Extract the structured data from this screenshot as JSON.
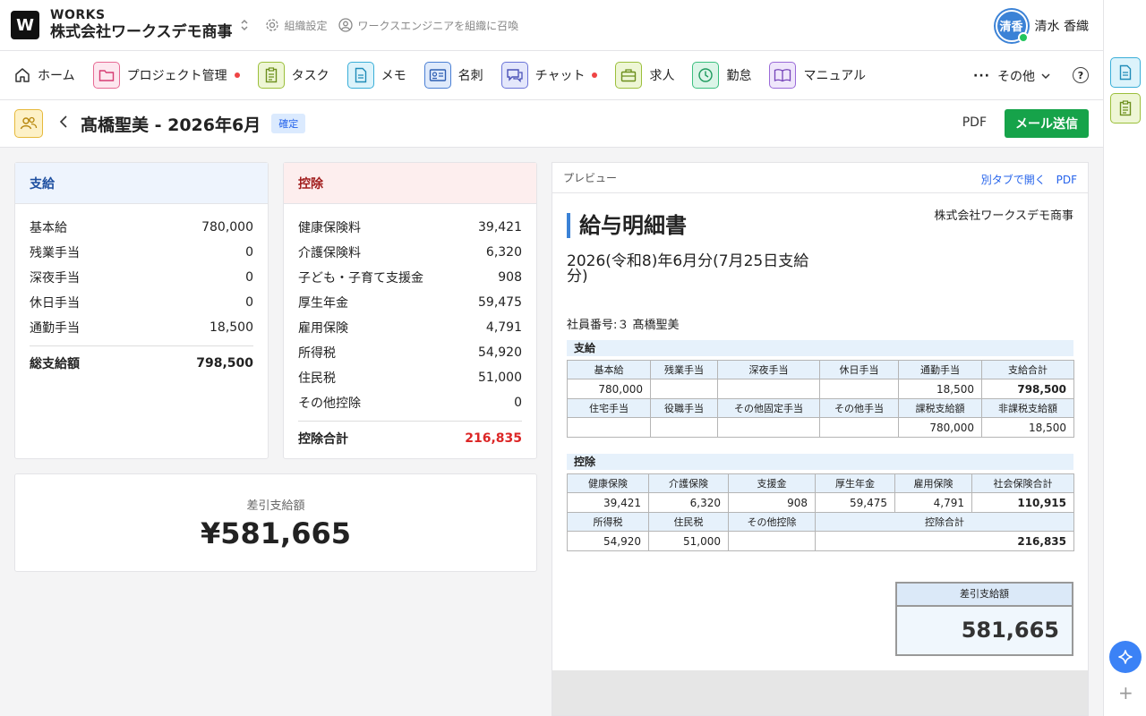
{
  "header": {
    "logo": "W",
    "brand_top": "WORKS",
    "org_name": "株式会社ワークスデモ商事",
    "org_settings": "組織設定",
    "invite": "ワークスエンジニアを組織に召喚",
    "avatar_text": "清香",
    "user_name": "清水 香織"
  },
  "nav": {
    "items": [
      {
        "label": "ホーム"
      },
      {
        "label": "プロジェクト管理"
      },
      {
        "label": "タスク"
      },
      {
        "label": "メモ"
      },
      {
        "label": "名刺"
      },
      {
        "label": "チャット"
      },
      {
        "label": "求人"
      },
      {
        "label": "勤怠"
      },
      {
        "label": "マニュアル"
      }
    ],
    "more": "その他",
    "help": "?"
  },
  "page": {
    "title": "髙橋聖美 - 2026年6月",
    "badge": "確定",
    "pdf": "PDF",
    "send_mail": "メール送信"
  },
  "payment": {
    "title": "支給",
    "rows": [
      {
        "label": "基本給",
        "value": "780,000"
      },
      {
        "label": "残業手当",
        "value": "0"
      },
      {
        "label": "深夜手当",
        "value": "0"
      },
      {
        "label": "休日手当",
        "value": "0"
      },
      {
        "label": "通勤手当",
        "value": "18,500"
      }
    ],
    "total_label": "総支給額",
    "total_value": "798,500"
  },
  "deduction": {
    "title": "控除",
    "rows": [
      {
        "label": "健康保険料",
        "value": "39,421"
      },
      {
        "label": "介護保険料",
        "value": "6,320"
      },
      {
        "label": "子ども・子育て支援金",
        "value": "908"
      },
      {
        "label": "厚生年金",
        "value": "59,475"
      },
      {
        "label": "雇用保険",
        "value": "4,791"
      },
      {
        "label": "所得税",
        "value": "54,920"
      },
      {
        "label": "住民税",
        "value": "51,000"
      },
      {
        "label": "その他控除",
        "value": "0"
      }
    ],
    "total_label": "控除合計",
    "total_value": "216,835"
  },
  "net": {
    "label": "差引支給額",
    "value": "¥581,665"
  },
  "preview": {
    "label": "プレビュー",
    "open_tab": "別タブで開く",
    "pdf": "PDF",
    "title": "給与明細書",
    "company": "株式会社ワークスデモ商事",
    "period": "2026(令和8)年6月分(7月25日支給分)",
    "employee": "社員番号:３ 髙橋聖美",
    "pay_section": "支給",
    "pay_h1": [
      "基本給",
      "残業手当",
      "深夜手当",
      "休日手当",
      "通勤手当",
      "支給合計"
    ],
    "pay_v1": [
      "780,000",
      "",
      "",
      "",
      "18,500",
      "798,500"
    ],
    "pay_h2": [
      "住宅手当",
      "役職手当",
      "その他固定手当",
      "その他手当",
      "課税支給額",
      "非課税支給額"
    ],
    "pay_v2": [
      "",
      "",
      "",
      "",
      "780,000",
      "18,500"
    ],
    "ded_section": "控除",
    "ded_h1": [
      "健康保険",
      "介護保険",
      "支援金",
      "厚生年金",
      "雇用保険",
      "社会保険合計"
    ],
    "ded_v1": [
      "39,421",
      "6,320",
      "908",
      "59,475",
      "4,791",
      "110,915"
    ],
    "ded_h2": [
      "所得税",
      "住民税",
      "その他控除",
      "控除合計"
    ],
    "ded_v2": [
      "54,920",
      "51,000",
      "",
      "216,835"
    ],
    "net_label": "差引支給額",
    "net_value": "581,665"
  },
  "colors": {
    "accent_green": "#16a34a",
    "accent_blue": "#3b82d6",
    "deduction_total": "#dc2626"
  }
}
